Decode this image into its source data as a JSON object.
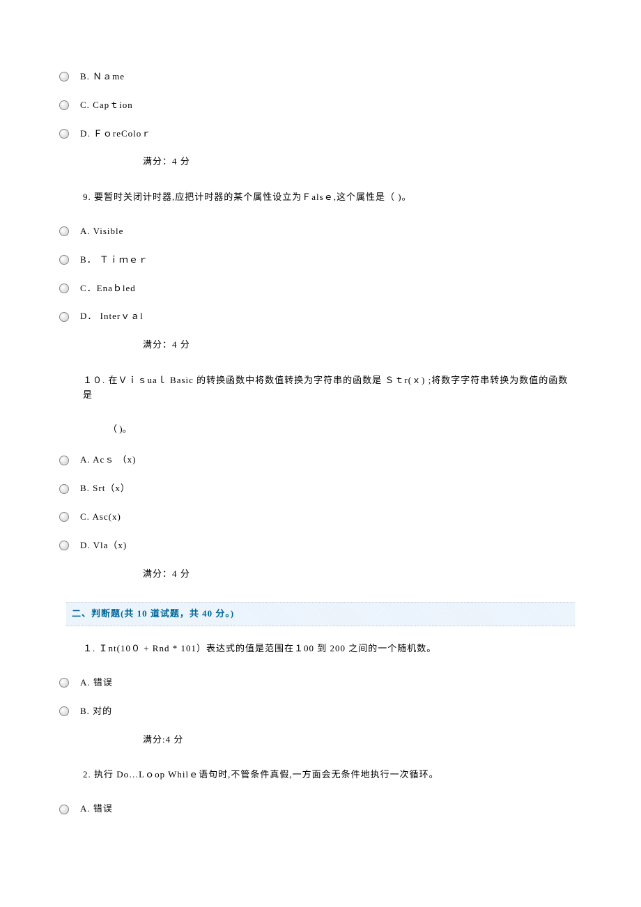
{
  "opts_block1": {
    "b": "B.  Ｎａme",
    "c": "C.  Capｔion",
    "d": "D.  ＦｏreColoｒ"
  },
  "score1": "满分：4    分",
  "q9": "9.        要暂时关闭计时器,应把计时器的某个属性设立为Ｆalsｅ,这个属性是（   )。",
  "opts_q9": {
    "a": "A.  Visible",
    "b": "B．  Ｔｉｍｅｒ",
    "c": "C．Enaｂled",
    "d": "D．  Interｖａl"
  },
  "score2": "满分：4    分",
  "q10_line1": "１０.      在Ｖｉｓuaｌ  Basic 的转换函数中将数值转换为字符串的函数是   Ｓｔr(ｘ) ;将数字字符串转换为数值的函数是",
  "q10_line2": "（   )。",
  "opts_q10": {
    "a": "A.  Acｓ  （x)",
    "b": "B.  Srt（x）",
    "c": "C.   Asc(x)",
    "d": "D.  Vla（x)"
  },
  "score3": "满分：4    分",
  "section2": "二、判断题(共  10  道试题，共  40  分。)",
  "j1": "１.      Ｉnt(10０ + Rnd * 101）表达式的值是范围在１00 到 200 之间的一个随机数。",
  "opts_j1": {
    "a": "A.  错误",
    "b": "B.  对的"
  },
  "score4": "满分:4    分",
  "j2": "2.        执行 Do…Lｏop Whilｅ语句时,不管条件真假,一方面会无条件地执行一次循环。",
  "opts_j2": {
    "a": "A.  错误"
  }
}
